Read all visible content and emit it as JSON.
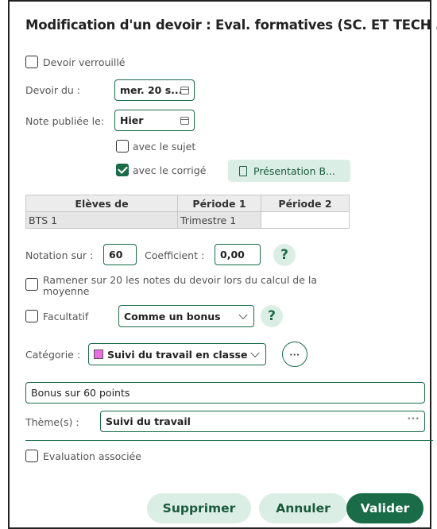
{
  "dialog": {
    "title": "Modification d'un devoir : Eval. formatives (SC. ET TECH ...",
    "locked_label": "Devoir verrouillé",
    "date_label": "Devoir du :",
    "date_value": "mer. 20 s...",
    "published_label": "Note publiée le:",
    "published_value": "Hier",
    "with_subject_label": "avec le sujet",
    "with_correction_label": "avec le corrigé",
    "pdf_button_label": "Présentation B...",
    "table": {
      "headers": [
        "Elèves de",
        "Période 1",
        "Période 2"
      ],
      "rows": [
        [
          "BTS 1",
          "Trimestre 1",
          ""
        ]
      ]
    },
    "notation_label": "Notation sur :",
    "notation_value": "60",
    "coefficient_label": "Coefficient :",
    "coefficient_value": "0,00",
    "help_glyph": "?",
    "bring_to_20_label": "Ramener sur 20 les notes du devoir lors du calcul de la moyenne",
    "optional_label": "Facultatif",
    "optional_select_value": "Comme un bonus",
    "category_label": "Catégorie :",
    "category_value": "Suivi du travail en classe",
    "category_color": "#e86fe0",
    "more_glyph": "···",
    "comment_value": "Bonus sur 60 points",
    "themes_label": "Thème(s) :",
    "themes_value": "Suivi du travail",
    "themes_more": "•••",
    "associated_eval_label": "Evaluation associée",
    "buttons": {
      "delete": "Supprimer",
      "cancel": "Annuler",
      "validate": "Valider"
    },
    "accent_color": "#1a6b47"
  }
}
